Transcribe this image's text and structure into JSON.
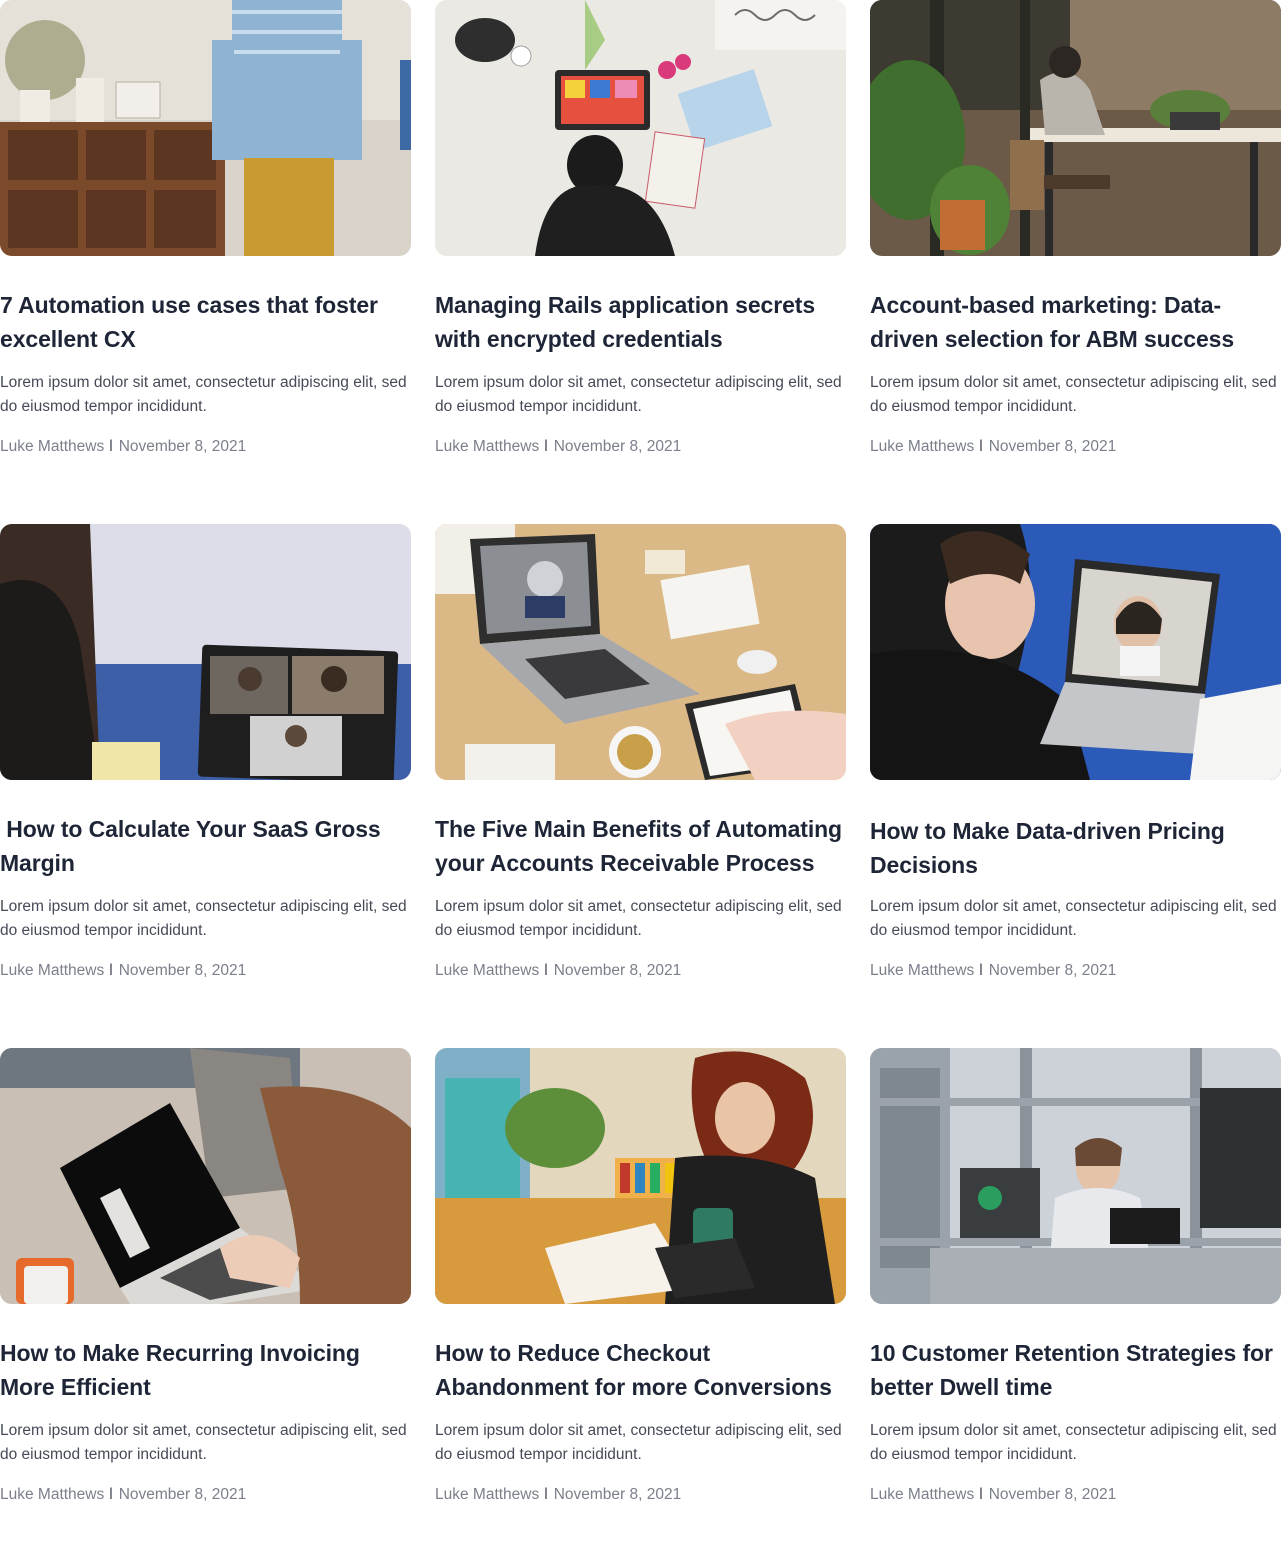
{
  "posts": [
    {
      "title": "7 Automation use cases that foster excellent CX",
      "excerpt": "Lorem ipsum dolor sit amet, consectetur adipiscing elit, sed do eiusmod tempor incididunt.",
      "author": "Luke Matthews",
      "separator": "l",
      "date": "November 8, 2021",
      "image": "person-standing-by-shelf"
    },
    {
      "title": "Managing Rails application secrets with encrypted credentials",
      "excerpt": "Lorem ipsum dolor sit amet, consectetur adipiscing elit, sed do eiusmod tempor incididunt.",
      "author": "Luke Matthews",
      "separator": "l",
      "date": "November 8, 2021",
      "image": "designer-desk-top-view"
    },
    {
      "title": "Account-based marketing: Data-driven selection for ABM success",
      "excerpt": "Lorem ipsum dolor sit amet, consectetur adipiscing elit, sed do eiusmod tempor incididunt.",
      "author": "Luke Matthews",
      "separator": "l",
      "date": "November 8, 2021",
      "image": "woman-working-at-table-plants"
    },
    {
      "title": " How to Calculate Your SaaS Gross Margin",
      "excerpt": "Lorem ipsum dolor sit amet, consectetur adipiscing elit, sed do eiusmod tempor incididunt.",
      "author": "Luke Matthews",
      "separator": "l",
      "date": "November 8, 2021",
      "image": "video-call-laptop"
    },
    {
      "title": "The Five Main Benefits of Automating your Accounts Receivable Process",
      "excerpt": "Lorem ipsum dolor sit amet, consectetur adipiscing elit, sed do eiusmod tempor incididunt.",
      "author": "Luke Matthews",
      "separator": "l",
      "date": "November 8, 2021",
      "image": "laptop-video-call-desk"
    },
    {
      "title": "How to Make Data-driven Pricing Decisions",
      "excerpt": "Lorem ipsum dolor sit amet, consectetur adipiscing elit, sed do eiusmod tempor incididunt.",
      "author": "Luke Matthews",
      "separator": "l",
      "date": "November 8, 2021",
      "image": "woman-video-call-earbuds"
    },
    {
      "title": "How to Make Recurring Invoicing More Efficient",
      "excerpt": "Lorem ipsum dolor sit amet, consectetur adipiscing elit, sed do eiusmod tempor incididunt.",
      "author": "Luke Matthews",
      "separator": "l",
      "date": "November 8, 2021",
      "image": "woman-typing-laptop"
    },
    {
      "title": "How to Reduce Checkout Abandonment for more Conversions",
      "excerpt": "Lorem ipsum dolor sit amet, consectetur adipiscing elit, sed do eiusmod tempor incididunt.",
      "author": "Luke Matthews",
      "separator": "l",
      "date": "November 8, 2021",
      "image": "woman-writing-with-mug"
    },
    {
      "title": "10 Customer Retention Strategies for better Dwell time",
      "excerpt": "Lorem ipsum dolor sit amet, consectetur adipiscing elit, sed do eiusmod tempor incididunt.",
      "author": "Luke Matthews",
      "separator": "l",
      "date": "November 8, 2021",
      "image": "engineer-in-lab"
    }
  ],
  "colors": {
    "title": "#1e2536",
    "excerpt": "#454a56",
    "meta": "#7a7f8a"
  }
}
